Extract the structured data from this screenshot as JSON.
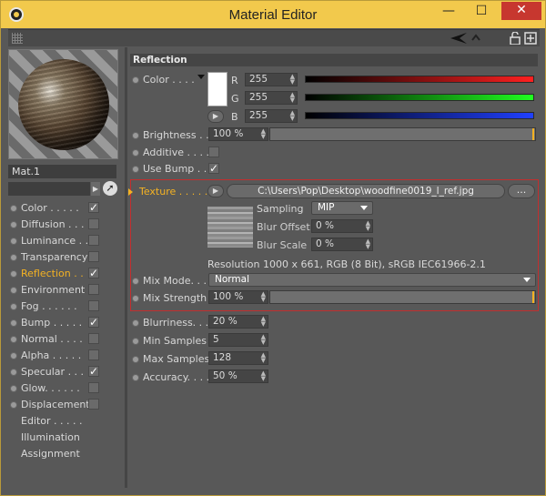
{
  "window": {
    "title": "Material Editor",
    "minimize": "—",
    "maximize": "☐",
    "close": "✕"
  },
  "material": {
    "name": "Mat.1",
    "search_value": ""
  },
  "channels": [
    {
      "label": "Color . . . . .",
      "checked": true,
      "active": false
    },
    {
      "label": "Diffusion . . .",
      "checked": false,
      "active": false
    },
    {
      "label": "Luminance . . .",
      "checked": false,
      "active": false
    },
    {
      "label": "Transparency",
      "checked": false,
      "active": false
    },
    {
      "label": "Reflection . .",
      "checked": true,
      "active": true
    },
    {
      "label": "Environment",
      "checked": false,
      "active": false
    },
    {
      "label": "Fog . . . . . .",
      "checked": false,
      "active": false
    },
    {
      "label": "Bump . . . . .",
      "checked": true,
      "active": false
    },
    {
      "label": "Normal . . . .",
      "checked": false,
      "active": false
    },
    {
      "label": "Alpha . . . . .",
      "checked": false,
      "active": false
    },
    {
      "label": "Specular . . .",
      "checked": true,
      "active": false
    },
    {
      "label": "Glow. . . . . .",
      "checked": false,
      "active": false
    },
    {
      "label": "Displacement",
      "checked": false,
      "active": false
    }
  ],
  "extra_items": [
    "Editor . . . . .",
    "Illumination",
    "Assignment"
  ],
  "section": {
    "title": "Reflection"
  },
  "color": {
    "label": "Color . . . .",
    "r_label": "R",
    "g_label": "G",
    "b_label": "B",
    "r": "255",
    "g": "255",
    "b": "255",
    "swatch": "#ffffff"
  },
  "brightness": {
    "label": "Brightness . .",
    "value": "100 %",
    "fraction": 1.0
  },
  "additive": {
    "label": "Additive . . . .",
    "checked": false
  },
  "use_bump": {
    "label": "Use Bump . .",
    "checked": true
  },
  "texture": {
    "label": "Texture . . . . .",
    "path": "C:\\Users\\Pop\\Desktop\\woodfine0019_l_ref.jpg",
    "more_button": "...",
    "sampling_label": "Sampling",
    "sampling_value": "MIP",
    "blur_offset_label": "Blur Offset",
    "blur_offset_value": "0 %",
    "blur_scale_label": "Blur Scale",
    "blur_scale_value": "0 %",
    "resolution": "Resolution 1000 x 661, RGB (8 Bit), sRGB IEC61966-2.1"
  },
  "mix_mode": {
    "label": "Mix Mode. . .",
    "value": "Normal"
  },
  "mix_strength": {
    "label": "Mix Strength",
    "value": "100 %",
    "fraction": 1.0
  },
  "blurriness": {
    "label": "Blurriness. . .",
    "value": "20 %"
  },
  "min_samples": {
    "label": "Min Samples",
    "value": "5"
  },
  "max_samples": {
    "label": "Max Samples",
    "value": "128"
  },
  "accuracy": {
    "label": "Accuracy. . . .",
    "value": "50 %"
  },
  "colors": {
    "accent": "#f4b223",
    "title_bar": "#f2c94c",
    "close": "#c7372f",
    "highlight_border": "#c22f2f"
  }
}
